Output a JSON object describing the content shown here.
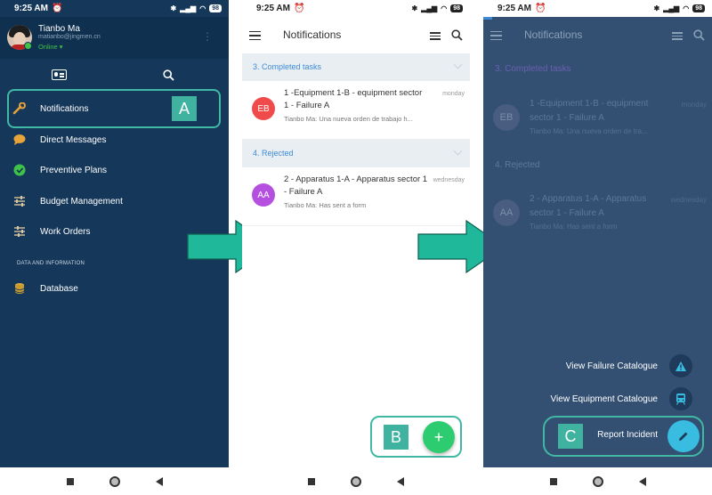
{
  "status": {
    "time": "9:25 AM",
    "battery": "98"
  },
  "panel1": {
    "profile": {
      "name": "Tianbo Ma",
      "email": "matianbo@jingmen.cn",
      "status": "Online"
    },
    "menu": [
      {
        "label": "Notifications"
      },
      {
        "label": "Direct Messages"
      },
      {
        "label": "Preventive Plans"
      },
      {
        "label": "Budget Management"
      },
      {
        "label": "Work Orders"
      }
    ],
    "section": "DATA AND INFORMATION",
    "database_label": "Database",
    "badge": "A"
  },
  "panel2": {
    "title": "Notifications",
    "groups": [
      {
        "header": "3. Completed tasks",
        "item": {
          "avatar": "EB",
          "title": "1 -Equipment 1-B - equipment sector 1 - Failure A",
          "subtitle": "Tianbo Ma: Una nueva orden de trabajo h...",
          "day": "monday"
        }
      },
      {
        "header": "4. Rejected",
        "item": {
          "avatar": "AA",
          "title": "2 - Apparatus 1-A - Apparatus sector 1 - Failure A",
          "subtitle": "Tianbo Ma: Has sent a form",
          "day": "wednesday"
        }
      }
    ],
    "fab_symbol": "+",
    "badge": "B"
  },
  "panel3": {
    "title": "Notifications",
    "groups": [
      {
        "header": "3. Completed tasks",
        "item": {
          "avatar": "EB",
          "title": "1 -Equipment 1-B - equipment sector 1 - Failure A",
          "subtitle": "Tianbo Ma: Una nueva orden de tra...",
          "day": "monday"
        }
      },
      {
        "header": "4. Rejected",
        "item": {
          "avatar": "AA",
          "title": "2 - Apparatus 1-A - Apparatus sector 1 - Failure A",
          "subtitle": "Tianbo Ma: Has sent a form",
          "day": "wednesday"
        }
      }
    ],
    "speed_dial": [
      {
        "label": "View Failure Catalogue",
        "icon": "warning-icon"
      },
      {
        "label": "View Equipment Catalogue",
        "icon": "train-icon"
      },
      {
        "label": "Report Incident",
        "icon": "pencil-icon"
      }
    ],
    "badge": "C"
  },
  "colors": {
    "drawer": "#15385a",
    "highlight": "#40b8a4",
    "badge": "#3fb39f",
    "accent_blue": "#3d8bd6",
    "fab_green": "#2ecc71",
    "fab_cyan": "#38bde0",
    "avatar_eb": "#f04a4a",
    "avatar_aa": "#b44fe0"
  }
}
